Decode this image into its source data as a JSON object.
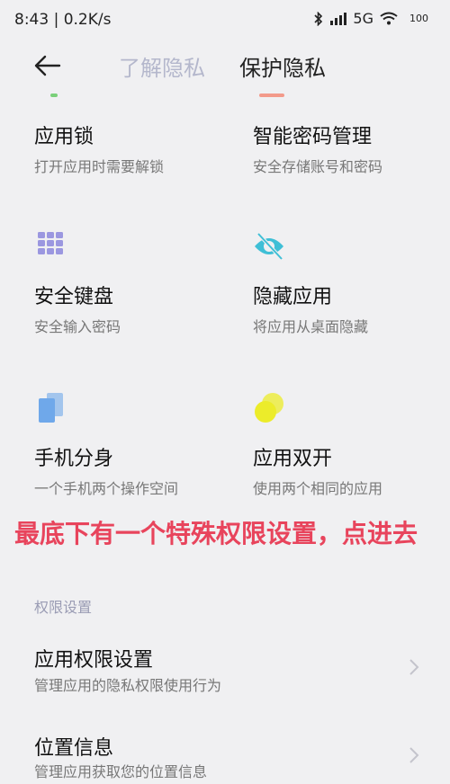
{
  "status_bar": {
    "time": "8:43 | 0.2K/s",
    "network": "5G",
    "battery": "100"
  },
  "header": {
    "tabs": [
      {
        "label": "了解隐私",
        "active": false
      },
      {
        "label": "保护隐私",
        "active": true
      }
    ]
  },
  "features": [
    {
      "title": "应用锁",
      "desc": "打开应用时需要解锁"
    },
    {
      "title": "智能密码管理",
      "desc": "安全存储账号和密码"
    },
    {
      "title": "安全键盘",
      "desc": "安全输入密码",
      "icon": "keypad-icon"
    },
    {
      "title": "隐藏应用",
      "desc": "将应用从桌面隐藏",
      "icon": "eye-hidden-icon"
    },
    {
      "title": "手机分身",
      "desc": "一个手机两个操作空间",
      "icon": "clone-phone-icon"
    },
    {
      "title": "应用双开",
      "desc": "使用两个相同的应用",
      "icon": "dual-app-icon"
    }
  ],
  "annotation": "最底下有一个特殊权限设置，点进去",
  "section_label": "权限设置",
  "list": [
    {
      "title": "应用权限设置",
      "desc": "管理应用的隐私权限使用行为"
    },
    {
      "title": "位置信息",
      "desc": "管理应用获取您的位置信息"
    }
  ],
  "colors": {
    "accent_red": "#e8445c",
    "inactive_tab": "#b4b7cc",
    "keypad_purple": "#9b97e0",
    "eye_teal": "#3fbfd6",
    "clone_blue": "#6fa8ea",
    "dual_yellow": "#ecec2a"
  }
}
